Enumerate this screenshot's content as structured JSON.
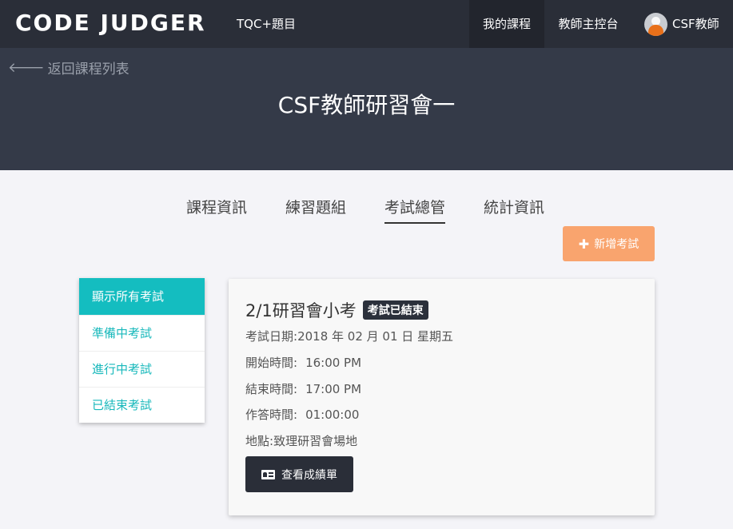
{
  "navbar": {
    "brand": "CODE JUDGER",
    "problems_link": "TQC+題目",
    "my_courses": "我的課程",
    "teacher_console": "教師主控台",
    "user_name": "CSF教師"
  },
  "hero": {
    "back_label": "返回課程列表",
    "course_title": "CSF教師研習會一"
  },
  "tabs": [
    {
      "label": "課程資訊"
    },
    {
      "label": "練習題組"
    },
    {
      "label": "考試總管",
      "active": true
    },
    {
      "label": "統計資訊"
    }
  ],
  "actions": {
    "add_exam": "新增考試"
  },
  "sidebar": {
    "items": [
      {
        "label": "顯示所有考試",
        "active": true
      },
      {
        "label": "準備中考試"
      },
      {
        "label": "進行中考試"
      },
      {
        "label": "已結束考試"
      }
    ]
  },
  "exam": {
    "title": "2/1研習會小考",
    "status": "考試已結束",
    "date_label": "考試日期:",
    "date_value": "2018 年 02 月 01 日 星期五",
    "start_label": "開始時間:",
    "start_value": "16:00 PM",
    "end_label": "結束時間:",
    "end_value": "17:00 PM",
    "duration_label": "作答時間:",
    "duration_value": "01:00:00",
    "location_label": "地點:",
    "location_value": "致理研習會場地",
    "score_button": "查看成績單"
  },
  "colors": {
    "navbar_bg": "#2a2e38",
    "hero_bg": "#343a48",
    "accent_teal": "#14bdc0",
    "add_button": "#f9a46e"
  }
}
